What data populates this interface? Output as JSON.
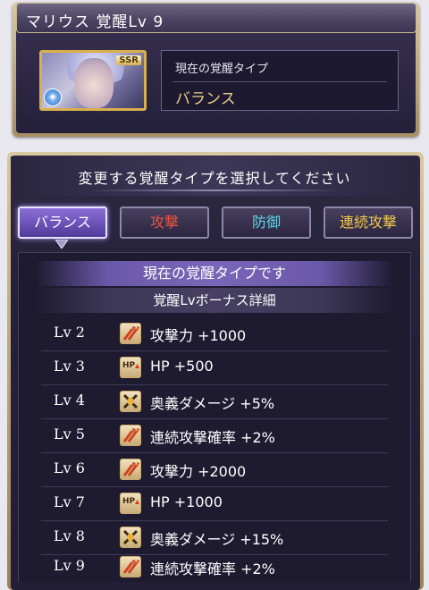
{
  "header": {
    "title": "マリウス 覚醒Lv 9",
    "rarity_badge": "SSR"
  },
  "current_type": {
    "label": "現在の覚醒タイプ",
    "value": "バランス"
  },
  "selector": {
    "prompt": "変更する覚醒タイプを選択してください",
    "buttons": [
      {
        "label": "バランス",
        "color": "#ffffff",
        "active": true
      },
      {
        "label": "攻撃",
        "color": "#f0523c",
        "active": false
      },
      {
        "label": "防御",
        "color": "#5bd8e8",
        "active": false
      },
      {
        "label": "連続攻撃",
        "color": "#f4c84a",
        "active": false
      }
    ]
  },
  "status_banner": "現在の覚醒タイプです",
  "bonus_header": "覚醒Lvボーナス詳細",
  "bonus_rows": [
    {
      "level": "Lv 2",
      "icon": "attack-icon",
      "text": "攻撃力 +1000"
    },
    {
      "level": "Lv 3",
      "icon": "hp-icon",
      "text": "HP +500"
    },
    {
      "level": "Lv 4",
      "icon": "ougi-icon",
      "text": "奥義ダメージ +5%"
    },
    {
      "level": "Lv 5",
      "icon": "attack-icon",
      "text": "連続攻撃確率 +2%"
    },
    {
      "level": "Lv 6",
      "icon": "attack-icon",
      "text": "攻撃力 +2000"
    },
    {
      "level": "Lv 7",
      "icon": "hp-icon",
      "text": "HP +1000"
    },
    {
      "level": "Lv 8",
      "icon": "ougi-icon",
      "text": "奥義ダメージ +15%"
    },
    {
      "level": "Lv 9",
      "icon": "attack-icon",
      "text": "連続攻撃確率 +2%"
    }
  ],
  "colors": {
    "accent_gold": "#e9cf8a",
    "active_button": "#8b6fd8",
    "panel_background": "#24203a"
  }
}
